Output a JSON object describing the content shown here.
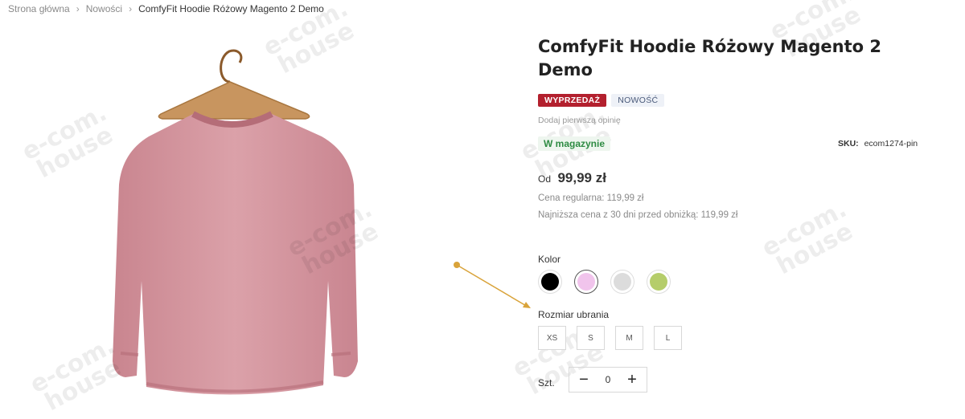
{
  "breadcrumb": {
    "items": [
      "Strona główna",
      "Nowości"
    ],
    "current": "ComfyFit Hoodie Różowy Magento 2 Demo"
  },
  "watermark": "e-com.\nhouse",
  "product": {
    "title": "ComfyFit Hoodie Różowy Magento 2 Demo",
    "badges": {
      "sale": "WYPRZEDAŻ",
      "new": "NOWOŚĆ"
    },
    "review_link": "Dodaj pierwszą opinię",
    "stock": "W magazynie",
    "sku_label": "SKU:",
    "sku_value": "ecom1274-pin",
    "price_prefix": "Od",
    "price": "99,99 zł",
    "regular_price": "Cena regularna: 119,99 zł",
    "lowest_price": "Najniższa cena z 30 dni przed obniżką: 119,99 zł",
    "hoodie_color": "#d89aa3"
  },
  "options": {
    "color_label": "Kolor",
    "colors": [
      {
        "name": "black",
        "hex": "#000000",
        "selected": false
      },
      {
        "name": "pink",
        "hex": "#f1c4ec",
        "selected": true
      },
      {
        "name": "light-grey",
        "hex": "#dcdcdc",
        "selected": false
      },
      {
        "name": "lime",
        "hex": "#b5cd6a",
        "selected": false
      }
    ],
    "size_label": "Rozmiar ubrania",
    "sizes": [
      "XS",
      "S",
      "M",
      "L"
    ]
  },
  "quantity": {
    "label": "Szt.",
    "value": "0",
    "minus": "−",
    "plus": "+"
  },
  "annotation": {
    "arrow_color": "#d9a33a"
  }
}
